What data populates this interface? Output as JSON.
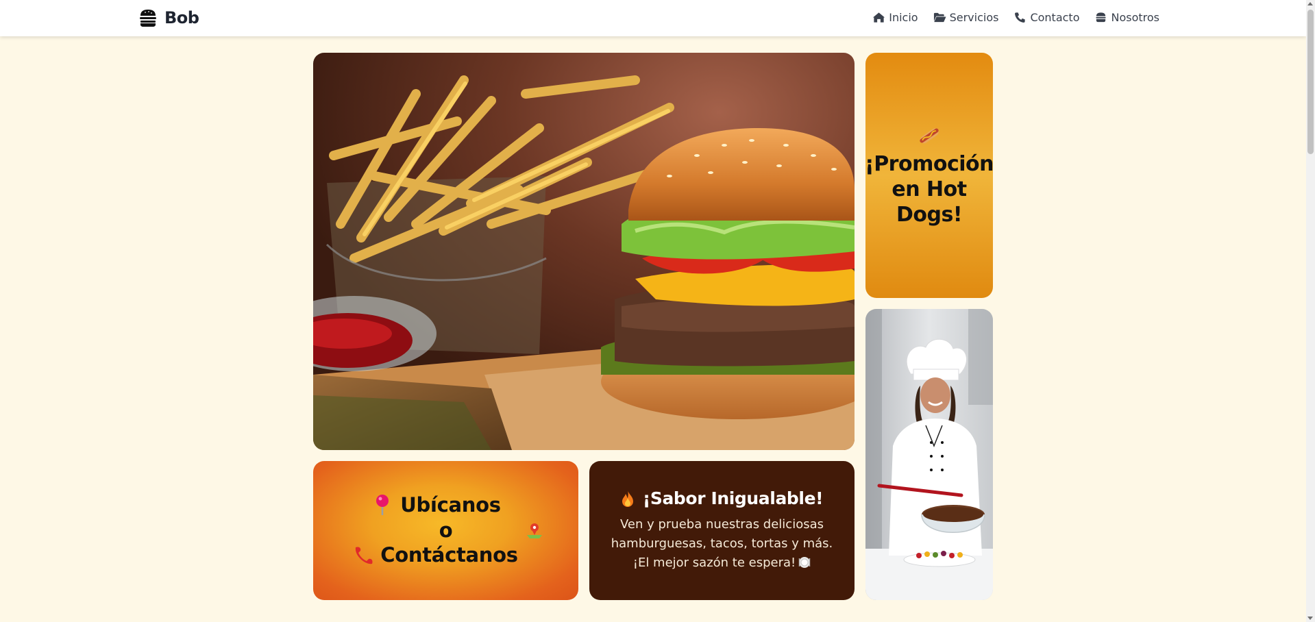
{
  "navbar": {
    "brand": "Bob",
    "brand_icon": "burger-icon",
    "links": [
      {
        "label": "Inicio",
        "icon": "home-icon"
      },
      {
        "label": "Servicios",
        "icon": "folder-open-icon"
      },
      {
        "label": "Contacto",
        "icon": "phone-icon"
      },
      {
        "label": "Nosotros",
        "icon": "burger-icon"
      }
    ]
  },
  "promo": {
    "emoji": "hotdog-icon",
    "title_lines": [
      "¡Promoción",
      "en Hot",
      "Dogs!"
    ]
  },
  "ubicanos": {
    "line1": "Ubícanos",
    "line2": "o",
    "line3": "Contáctanos"
  },
  "sabor": {
    "title": "¡Sabor Inigualable!",
    "text": "Ven y prueba nuestras deliciosas hamburguesas, tacos, tortas y más. ¡El mejor sazón te espera!"
  },
  "colors": {
    "page_bg": "#fef8e6",
    "promo_orange": "#f0b53a",
    "sabor_brown": "#421a08",
    "nav_text": "#3a414d"
  }
}
